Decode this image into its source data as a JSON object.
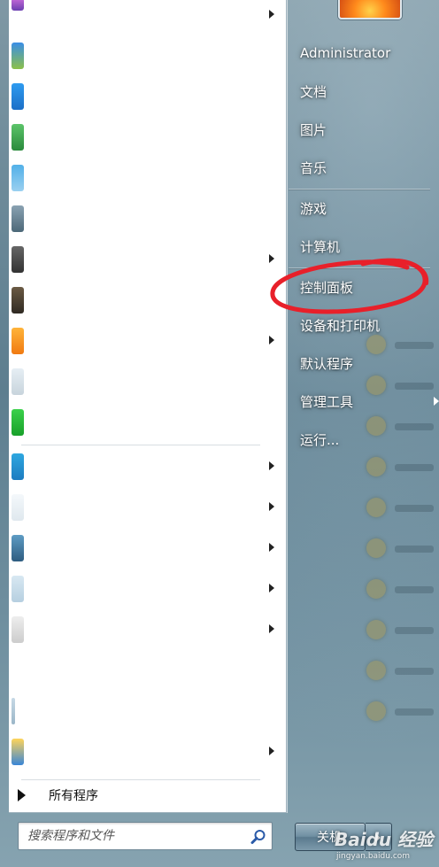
{
  "start_menu": {
    "user": {
      "name": "Administrator"
    },
    "right_items": [
      {
        "label": "文档"
      },
      {
        "label": "图片"
      },
      {
        "label": "音乐"
      },
      {
        "label": "游戏"
      },
      {
        "label": "计算机"
      },
      {
        "label": "控制面板"
      },
      {
        "label": "设备和打印机"
      },
      {
        "label": "默认程序"
      },
      {
        "label": "管理工具"
      },
      {
        "label": "运行..."
      }
    ],
    "all_programs_label": "所有程序",
    "search": {
      "placeholder": "搜索程序和文件",
      "value": ""
    },
    "shutdown": {
      "label": "关机"
    }
  },
  "watermark": {
    "main": "Baidu 经验",
    "sub": "jingyan.baidu.com"
  },
  "colors": {
    "annotation": "#e8202a",
    "left_panel": "#ffffff",
    "glass": "#6e8b9a"
  },
  "icons": {
    "search": "search-icon",
    "submenu_arrow": "chevron-right-icon",
    "all_programs": "triangle-right-icon"
  }
}
